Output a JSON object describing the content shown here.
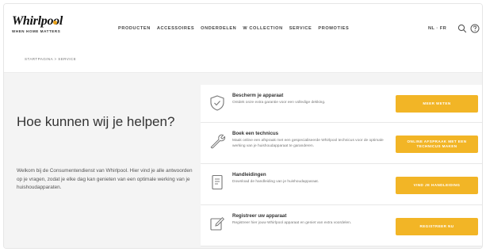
{
  "brand": {
    "logo_text": "Whirlpool",
    "tagline": "WHEN HOME MATTERS"
  },
  "nav": {
    "items": [
      "PRODUCTEN",
      "ACCESSOIRES",
      "ONDERDELEN",
      "W COLLECTION",
      "SERVICE",
      "PROMOTIES"
    ]
  },
  "header": {
    "language": "NL · FR"
  },
  "breadcrumb": "STARTPAGINA > SERVICE",
  "main": {
    "title": "Hoe kunnen wij je helpen?",
    "intro": "Welkom bij de Consumentendienst van Whirlpool. Hier vind je alle antwoorden op je vragen, zodat je elke dag kan genieten van een optimale werking van je huishoudapparaten."
  },
  "cards": [
    {
      "icon": "shield-icon",
      "title": "Bescherm je apparaat",
      "description": "Ontdek onze extra garantie voor een volledige dekking.",
      "button": "MEER WETEN"
    },
    {
      "icon": "wrench-icon",
      "title": "Boek een technicus",
      "description": "Maak online een afspraak met een gespecialiseerde Whirlpool technicus voor de optimale werking van je huishoudapparaat te garanderen.",
      "button": "ONLINE AFSPRAAK MET EEN TECHNICUS MAKEN"
    },
    {
      "icon": "manual-icon",
      "title": "Handleidingen",
      "description": "Download de handleiding van je huishoudapparaat.",
      "button": "VIND JE HANDLEIDING"
    },
    {
      "icon": "register-icon",
      "title": "Registreer uw apparaat",
      "description": "Registreer hier jouw Whirlpool apparaat en geniet van extra voordelen.",
      "button": "REGISTREER NU"
    }
  ],
  "colors": {
    "accent": "#f2b526",
    "background": "#f4f4f4"
  }
}
